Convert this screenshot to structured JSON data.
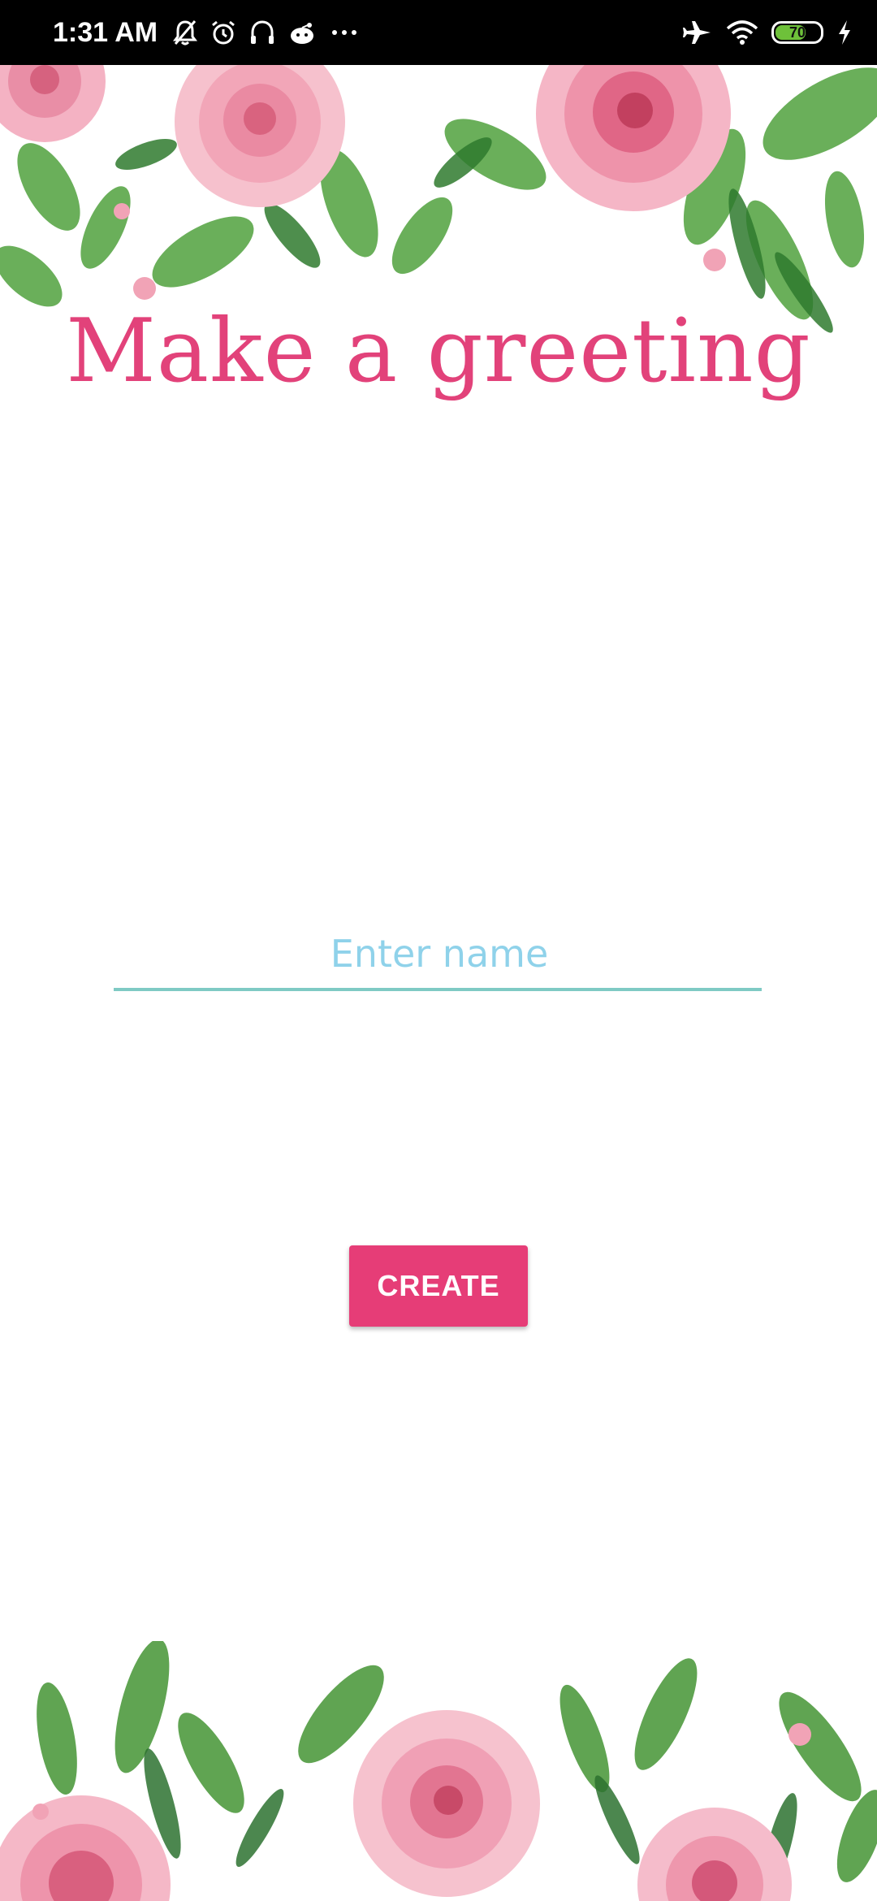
{
  "status_bar": {
    "time": "1:31 AM",
    "battery_level": "70",
    "battery_fraction": 0.7,
    "icons_left": [
      "muted-bell-icon",
      "alarm-icon",
      "headphones-icon",
      "notification-app-icon",
      "more-dots-icon"
    ],
    "icons_right": [
      "airplane-mode-icon",
      "wifi-icon",
      "battery-icon",
      "charging-icon"
    ]
  },
  "main": {
    "title": "Make a greeting",
    "name_input": {
      "placeholder": "Enter name",
      "value": ""
    },
    "create_button_label": "CREATE"
  },
  "colors": {
    "accent_pink": "#e63d77",
    "title_pink": "#e2427a",
    "input_underline": "#7fcac4",
    "placeholder_blue": "#8fd2ea",
    "leaf_green": "#4f9a3f",
    "rose_pink": "#f2a6b8"
  }
}
